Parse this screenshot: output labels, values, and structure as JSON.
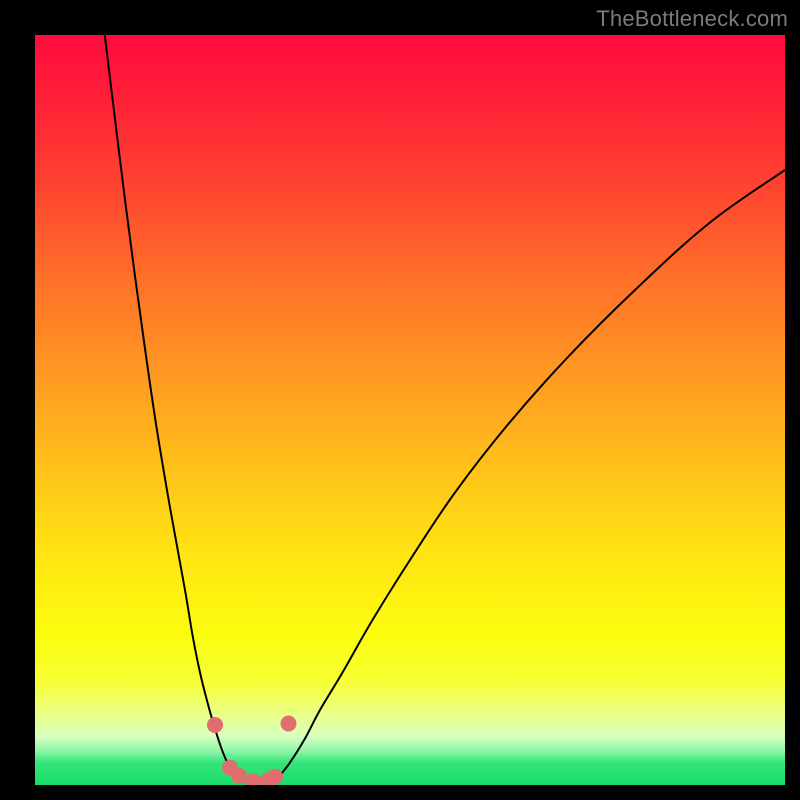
{
  "watermark": "TheBottleneck.com",
  "chart_data": {
    "type": "line",
    "title": "",
    "xlabel": "",
    "ylabel": "",
    "xlim": [
      0,
      100
    ],
    "ylim": [
      0,
      100
    ],
    "grid": false,
    "series": [
      {
        "name": "left-curve",
        "x": [
          9.3,
          12,
          14,
          16,
          18,
          20,
          21,
          22,
          23,
          24,
          25,
          26,
          27
        ],
        "y": [
          100,
          78,
          63,
          49,
          37,
          26,
          20,
          15,
          11,
          7.5,
          4.5,
          2.3,
          1.1
        ]
      },
      {
        "name": "right-curve",
        "x": [
          32.5,
          34,
          36,
          38,
          41,
          45,
          50,
          56,
          63,
          71,
          80,
          90,
          100
        ],
        "y": [
          1.1,
          3.0,
          6.2,
          10,
          15,
          22,
          30,
          39,
          48,
          57,
          66,
          75,
          82
        ]
      },
      {
        "name": "floor-segment",
        "x": [
          27,
          28.5,
          30,
          31,
          32.5
        ],
        "y": [
          1.1,
          0.55,
          0.4,
          0.55,
          1.1
        ]
      }
    ],
    "markers": [
      {
        "name": "left-marker-high",
        "x": 24.0,
        "y": 8.0
      },
      {
        "name": "left-marker-low-a",
        "x": 26.0,
        "y": 2.3
      },
      {
        "name": "left-marker-low-b",
        "x": 27.2,
        "y": 1.2
      },
      {
        "name": "floor-marker-a",
        "x": 29.0,
        "y": 0.5
      },
      {
        "name": "floor-marker-b",
        "x": 31.0,
        "y": 0.6
      },
      {
        "name": "right-marker-low",
        "x": 32.0,
        "y": 1.1
      },
      {
        "name": "right-marker-high",
        "x": 33.8,
        "y": 8.2
      }
    ],
    "marker_color": "#e06e6e",
    "curve_color": "#000000"
  }
}
